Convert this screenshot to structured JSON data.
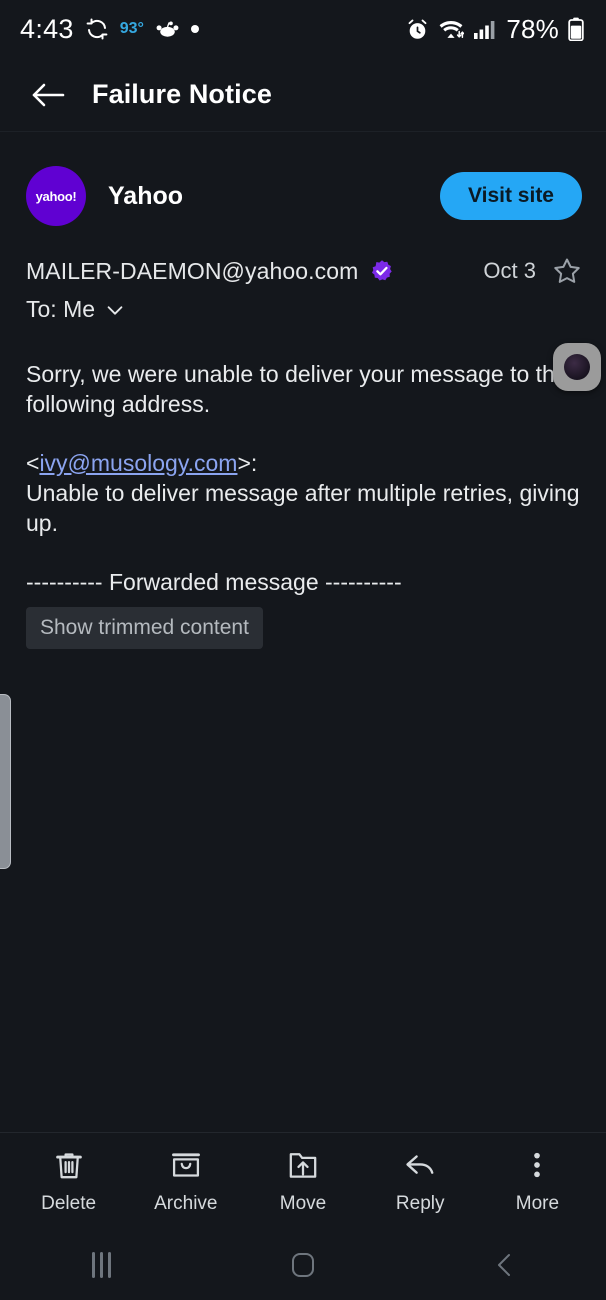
{
  "status_bar": {
    "time": "4:43",
    "temperature": "93°",
    "battery_percent": "78%",
    "icons": [
      "sync-icon",
      "reddit-icon",
      "dot-indicator",
      "alarm-icon",
      "wifi-icon",
      "cellular-signal-icon",
      "battery-icon"
    ]
  },
  "header": {
    "back_label": "back-arrow",
    "title": "Failure Notice"
  },
  "brand": {
    "avatar_text": "yahoo!",
    "name": "Yahoo",
    "visit_button": "Visit site",
    "avatar_color": "#6001d2",
    "button_color": "#25a7f5"
  },
  "overlay": {
    "camera_bubble": "camera-overlay-bubble"
  },
  "message": {
    "sender": "MAILER-DAEMON@yahoo.com",
    "verified": true,
    "date": "Oct 3",
    "starred": false,
    "to": "To: Me",
    "body_para1": "Sorry, we were unable to deliver your message to the following address.",
    "recipient_open": "<",
    "recipient_link": "ivy@musology.com",
    "recipient_close": ">:",
    "body_para2": "Unable to deliver message after multiple retries, giving up.",
    "forwarded_divider": "---------- Forwarded message ----------",
    "show_trimmed": "Show trimmed content",
    "link_color": "#8ba4f0"
  },
  "toolbar": {
    "items": [
      {
        "label": "Delete",
        "icon": "trash-icon"
      },
      {
        "label": "Archive",
        "icon": "archive-icon"
      },
      {
        "label": "Move",
        "icon": "move-folder-icon"
      },
      {
        "label": "Reply",
        "icon": "reply-arrow-icon"
      },
      {
        "label": "More",
        "icon": "more-vertical-icon"
      }
    ]
  },
  "nav_bar": {
    "recents": "recents-icon",
    "home": "home-icon",
    "back": "back-chevron-icon"
  }
}
